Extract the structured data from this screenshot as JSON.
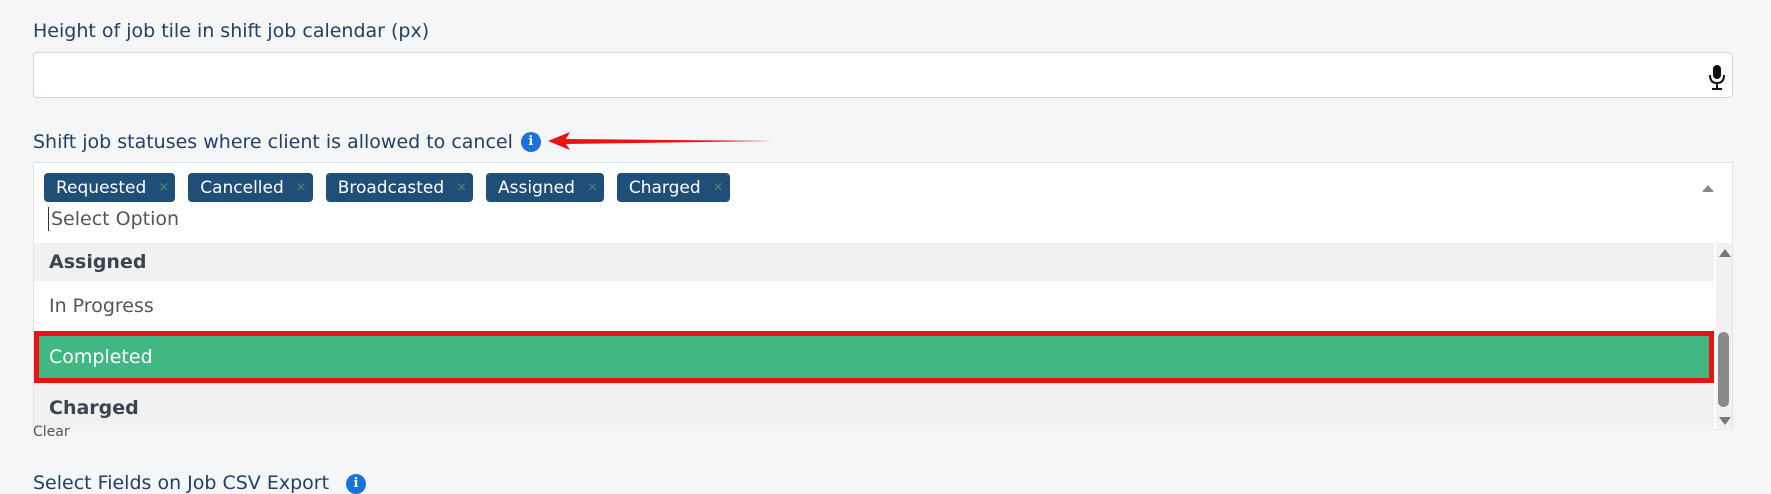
{
  "height_field": {
    "label": "Height of job tile in shift job calendar (px)",
    "value": "",
    "icon": "microphone-icon"
  },
  "statuses_field": {
    "label": "Shift job statuses where client is allowed to cancel",
    "info_icon": "i",
    "selected_tags": [
      "Requested",
      "Cancelled",
      "Broadcasted",
      "Assigned",
      "Charged"
    ],
    "tag_remove": "×",
    "search_placeholder": "Select Option",
    "options": [
      {
        "label": "Assigned",
        "state": "selected"
      },
      {
        "label": "In Progress",
        "state": "normal"
      },
      {
        "label": "Completed",
        "state": "highlighted"
      },
      {
        "label": "Charged",
        "state": "selected"
      }
    ]
  },
  "clear_link": "Clear",
  "csv_field": {
    "label": "Select Fields on Job CSV Export",
    "info_icon": "i"
  },
  "colors": {
    "tag_bg": "#1f4e79",
    "highlight_bg": "#41b883",
    "annotation_red": "#ee1111",
    "info_blue": "#1a73d9"
  }
}
